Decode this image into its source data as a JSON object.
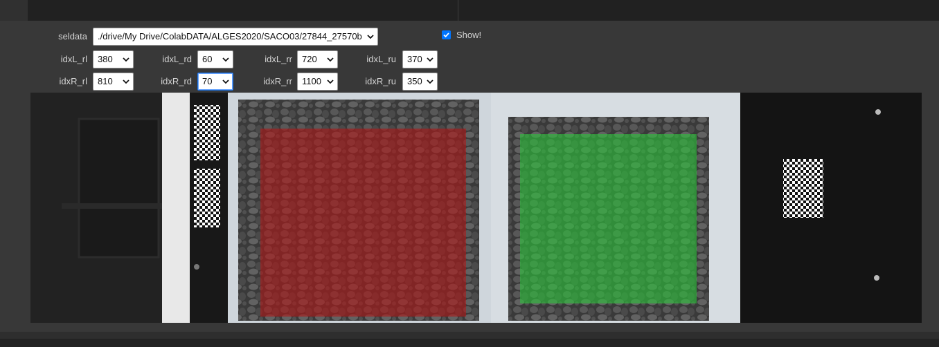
{
  "controls": {
    "seldata": {
      "label": "seldata",
      "value": "./drive/My Drive/ColabDATA/ALGES2020/SACO03/27844_27570b"
    },
    "show": {
      "label": "Show!",
      "checked": true
    },
    "idxL": [
      {
        "label": "idxL_rl",
        "value": "380"
      },
      {
        "label": "idxL_rd",
        "value": "60"
      },
      {
        "label": "idxL_rr",
        "value": "720"
      },
      {
        "label": "idxL_ru",
        "value": "370"
      }
    ],
    "idxR": [
      {
        "label": "idxR_rl",
        "value": "810"
      },
      {
        "label": "idxR_rd",
        "value": "70"
      },
      {
        "label": "idxR_rr",
        "value": "1100"
      },
      {
        "label": "idxR_ru",
        "value": "350"
      }
    ]
  },
  "image": {
    "left_overlay_color": "#b01818",
    "right_overlay_color": "#2cc43a"
  }
}
